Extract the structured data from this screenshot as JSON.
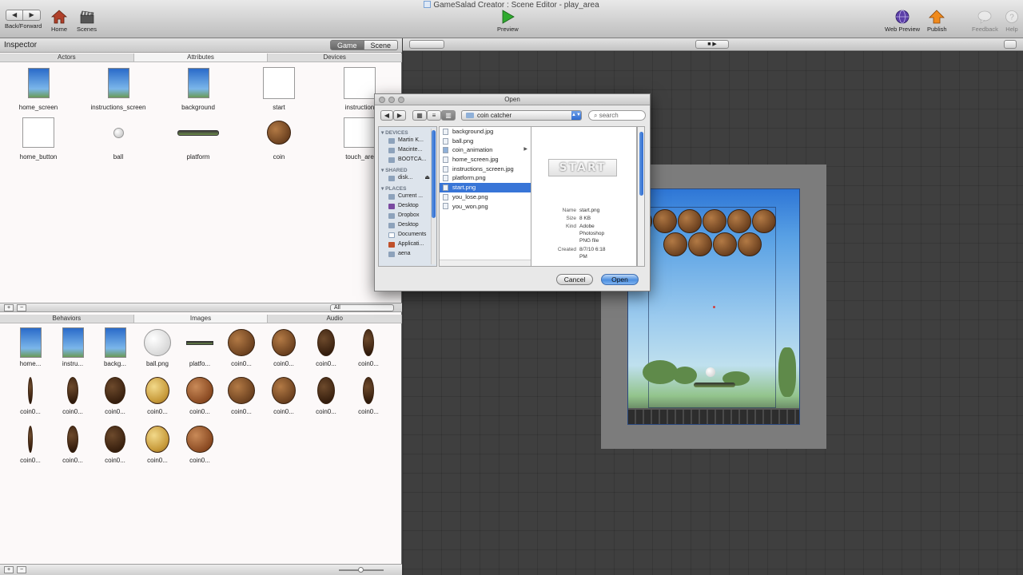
{
  "window": {
    "title": "GameSalad Creator : Scene Editor - play_area"
  },
  "toolbar": {
    "back_forward": "Back/Forward",
    "home": "Home",
    "scenes": "Scenes",
    "preview": "Preview",
    "web_preview": "Web Preview",
    "publish": "Publish",
    "feedback": "Feedback",
    "help": "Help"
  },
  "inspector": {
    "title": "Inspector",
    "mode_game": "Game",
    "mode_scene": "Scene",
    "tabs": [
      "Actors",
      "Attributes",
      "Devices"
    ],
    "actors": [
      "home_screen",
      "instructions_screen",
      "background",
      "start",
      "instruction",
      "home_button",
      "ball",
      "platform",
      "coin",
      "touch_are"
    ]
  },
  "library": {
    "filter": "All",
    "tabs": [
      "Behaviors",
      "Images",
      "Audio"
    ],
    "images": [
      "home...",
      "instru...",
      "backg...",
      "ball.png",
      "platfo...",
      "coin0...",
      "coin0...",
      "coin0...",
      "coin0...",
      "coin0...",
      "coin0...",
      "coin0...",
      "coin0...",
      "coin0...",
      "coin0...",
      "coin0...",
      "coin0...",
      "coin0...",
      "coin0...",
      "coin0...",
      "coin0...",
      "coin0...",
      "coin0..."
    ]
  },
  "dialog": {
    "title": "Open",
    "location": "coin catcher",
    "search_placeholder": "search",
    "sidebar": {
      "devices_header": "DEVICES",
      "devices": [
        "Martin K...",
        "Macinte...",
        "BOOTCA..."
      ],
      "shared_header": "SHARED",
      "shared": [
        "disk..."
      ],
      "places_header": "PLACES",
      "places": [
        "Current ...",
        "Desktop",
        "Dropbox",
        "Desktop",
        "Documents",
        "Applicati...",
        "aena"
      ]
    },
    "files": [
      "background.jpg",
      "ball.png",
      "coin_animation",
      "home_screen.jpg",
      "instructions_screen.jpg",
      "platform.png",
      "start.png",
      "you_lose.png",
      "you_won.png"
    ],
    "selected_file": "start.png",
    "preview": {
      "image_text": "START",
      "name_label": "Name",
      "name_value": "start.png",
      "size_label": "Size",
      "size_value": "8 KB",
      "kind_label": "Kind",
      "kind_value_1": "Adobe",
      "kind_value_2": "Photoshop",
      "kind_value_3": "PNG file",
      "created_label": "Created",
      "created_value_1": "8/7/10 6:18",
      "created_value_2": "PM"
    },
    "cancel": "Cancel",
    "open": "Open"
  },
  "colors": {
    "selection": "#3875d7",
    "preview_play": "#2faa2f",
    "publish": "#f08a1c"
  }
}
